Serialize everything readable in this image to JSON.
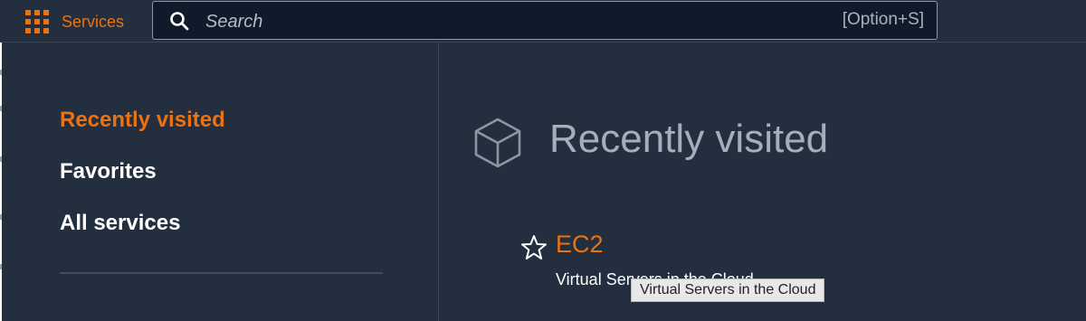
{
  "topbar": {
    "services_label": "Services",
    "search": {
      "placeholder": "Search",
      "shortcut": "[Option+S]"
    }
  },
  "leftnav": {
    "items": [
      {
        "label": "Recently visited",
        "active": true
      },
      {
        "label": "Favorites",
        "active": false
      },
      {
        "label": "All services",
        "active": false
      }
    ]
  },
  "content": {
    "title": "Recently visited",
    "services": [
      {
        "name": "EC2",
        "description": "Virtual Servers in the Cloud",
        "favorite": false
      }
    ]
  },
  "tooltip": {
    "text": "Virtual Servers in the Cloud"
  },
  "colors": {
    "background": "#232f3e",
    "accent": "#ec7211",
    "search_bg": "#0f1b2a",
    "title_gray": "#a3b0b9"
  },
  "icons": {
    "services": "grid-icon",
    "search": "search-icon",
    "section": "cube-icon",
    "favorite": "star-icon"
  }
}
